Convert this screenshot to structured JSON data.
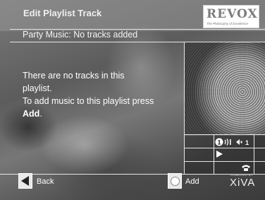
{
  "header": {
    "title": "Edit Playlist Track",
    "subtitle": "Party Music: No tracks added",
    "logo": "REVOX",
    "logo_tagline": "The Philosophy of Excellence"
  },
  "message": {
    "line1": "There are no tracks in this",
    "line2": "playlist.",
    "line3": "To add music to this playlist press",
    "emphasis": "Add",
    "end": "."
  },
  "status_panel": {
    "zone_number": "1",
    "volume_label": "1",
    "play_icon": "play-icon",
    "phone_icon": "phone-icon"
  },
  "footer": {
    "back_label": "Back",
    "add_label": "Add",
    "powered_by": "POWERED BY",
    "brand": "XiVA"
  }
}
